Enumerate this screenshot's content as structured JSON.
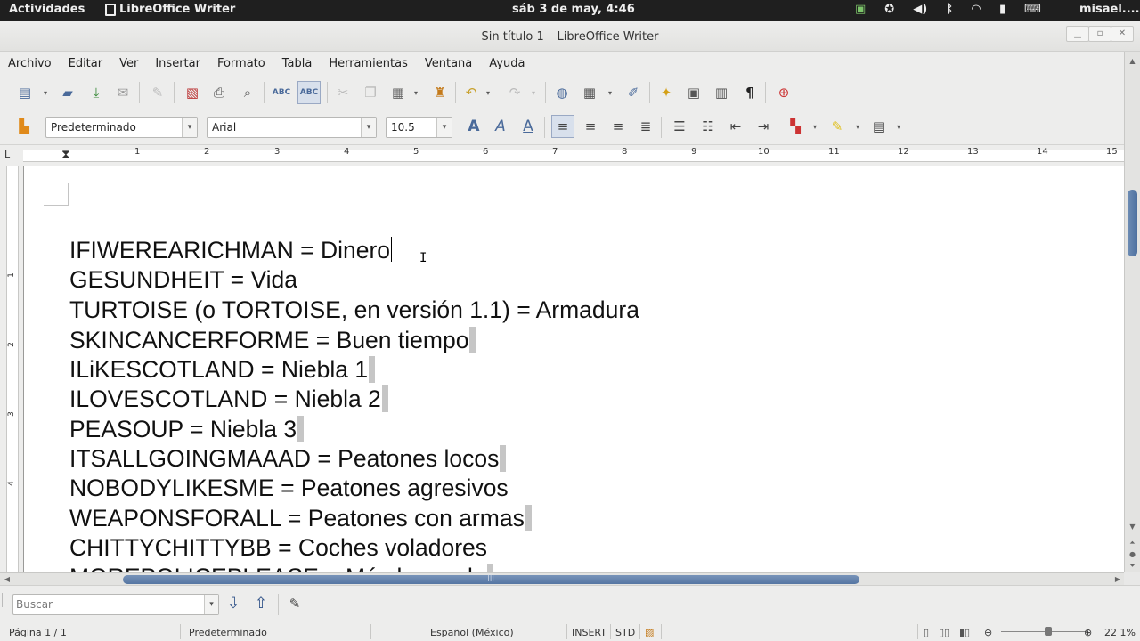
{
  "topbar": {
    "activities": "Actividades",
    "app_name": "LibreOffice Writer",
    "clock": "sáb  3 de may,  4:46",
    "user": "misael....",
    "tray_icons": [
      "network-indicator-icon",
      "accessibility-icon",
      "volume-icon",
      "bluetooth-icon",
      "wifi-icon",
      "battery-icon",
      "keyboard-icon"
    ]
  },
  "window": {
    "title": "Sin título 1 – LibreOffice Writer",
    "controls": [
      "minimize",
      "maximize",
      "close"
    ]
  },
  "menubar": {
    "items": [
      "Archivo",
      "Editar",
      "Ver",
      "Insertar",
      "Formato",
      "Tabla",
      "Herramientas",
      "Ventana",
      "Ayuda"
    ]
  },
  "formatting": {
    "paragraph_style": "Predeterminado",
    "font_name": "Arial",
    "font_size": "10.5"
  },
  "ruler": {
    "numbers": [
      "1",
      "2",
      "3",
      "4",
      "5",
      "6",
      "7",
      "8",
      "9",
      "10",
      "11",
      "12",
      "13",
      "14",
      "15"
    ],
    "corner_label": "L"
  },
  "vruler": {
    "numbers": [
      "1",
      "2",
      "3",
      "4"
    ]
  },
  "document": {
    "lines": [
      "IFIWEREARICHMAN = Dinero",
      "GESUNDHEIT = Vida",
      "TURTOISE (o TORTOISE, en versión 1.1) = Armadura",
      "SKINCANCERFORME = Buen tiempo",
      "ILiKESCOTLAND = Niebla 1",
      "ILOVESCOTLAND = Niebla 2",
      "PEASOUP = Niebla 3",
      "ITSALLGOINGMAAAD = Peatones locos",
      "NOBODYLIKESME = Peatones agresivos",
      "WEAPONSFORALL = Peatones con armas",
      "CHITTYCHITTYBB = Coches voladores",
      "MOREPOLICEPLEASE = Más buscado"
    ]
  },
  "findbar": {
    "placeholder": "Buscar"
  },
  "statusbar": {
    "page": "Página  1 / 1",
    "style": "Predeterminado",
    "language": "Español (México)",
    "insert_mode": "INSERT",
    "selection_mode": "STD",
    "zoom": "22 1%"
  }
}
